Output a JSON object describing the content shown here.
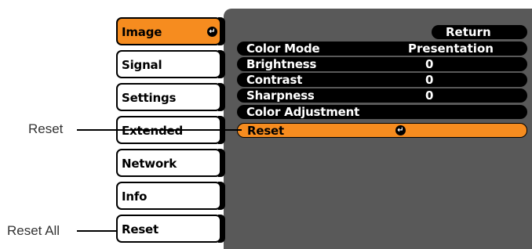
{
  "menu": {
    "items": [
      {
        "label": "Image"
      },
      {
        "label": "Signal"
      },
      {
        "label": "Settings"
      },
      {
        "label": "Extended"
      },
      {
        "label": "Network"
      },
      {
        "label": "Info"
      },
      {
        "label": "Reset"
      }
    ],
    "active_index": 0
  },
  "submenu": {
    "return_label": "Return",
    "rows": [
      {
        "label": "Color Mode",
        "value": "Presentation"
      },
      {
        "label": "Brightness",
        "value": "0"
      },
      {
        "label": "Contrast",
        "value": "0"
      },
      {
        "label": "Sharpness",
        "value": "0"
      },
      {
        "label": "Color Adjustment",
        "value": ""
      },
      {
        "label": "Reset",
        "value": ""
      }
    ],
    "active_row": "Reset"
  },
  "callouts": {
    "reset": "Reset",
    "reset_all": "Reset All"
  },
  "icons": {
    "enter": "enter-icon"
  },
  "colors": {
    "accent": "#f68c1f",
    "panel": "#595959",
    "row": "#000000"
  }
}
